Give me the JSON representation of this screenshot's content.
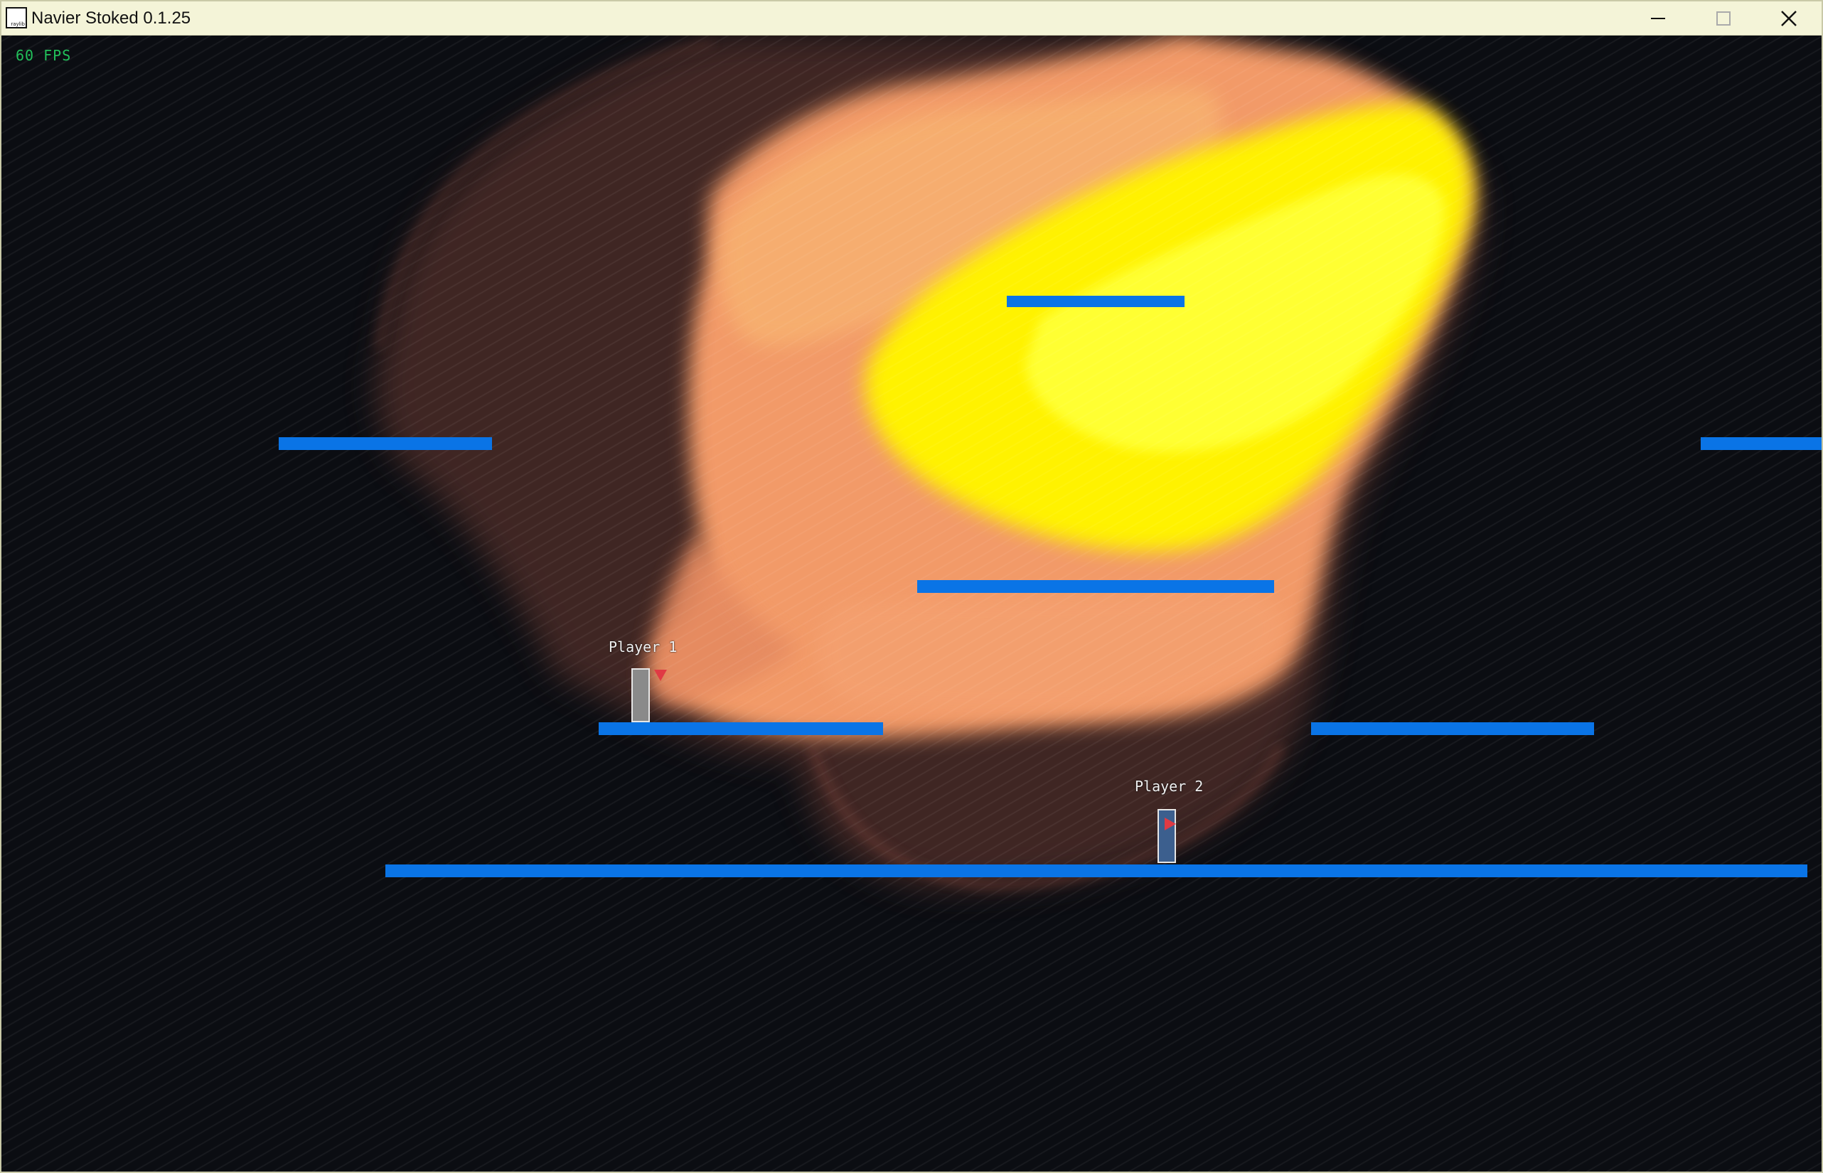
{
  "window": {
    "title": "Navier Stoked 0.1.25",
    "icon_label": "raylib",
    "controls": [
      "minimize-icon",
      "maximize-icon",
      "close-icon"
    ]
  },
  "hud": {
    "fps": "60 FPS"
  },
  "players": [
    {
      "label": "Player 1",
      "color": "#8a8a8a",
      "facing": "down"
    },
    {
      "label": "Player 2",
      "color": "#3c5f8e",
      "facing": "right"
    }
  ],
  "colors": {
    "background": "#0b0d12",
    "platform": "#0a74e6",
    "fps_text": "#22c05a",
    "fluid_hot": "#ffff00",
    "fluid_warm": "#f0a060",
    "fluid_cool": "#7a4236",
    "marker": "#e03a44"
  }
}
